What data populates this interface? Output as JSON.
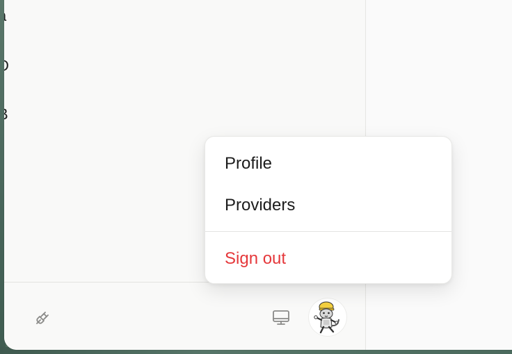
{
  "user_menu": {
    "items": [
      {
        "label": "Profile"
      },
      {
        "label": "Providers"
      }
    ],
    "sign_out_label": "Sign out"
  },
  "sidebar": {
    "footer": {
      "connect_icon": "plug-icon",
      "display_icon": "monitor-icon",
      "avatar_icon": "cartoon-cat-avatar"
    }
  },
  "colors": {
    "danger": "#e5383b",
    "surface": "#f9f9f8",
    "menu_bg": "#ffffff",
    "desktop": "#4e6b5c"
  }
}
